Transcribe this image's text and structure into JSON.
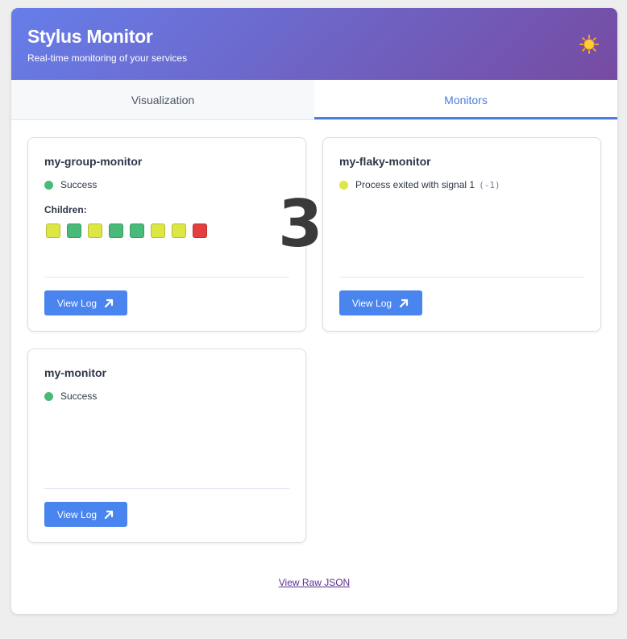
{
  "header": {
    "title": "Stylus Monitor",
    "subtitle": "Real-time monitoring of your services",
    "theme_icon": "sun-icon"
  },
  "tabs": [
    {
      "label": "Visualization",
      "active": false
    },
    {
      "label": "Monitors",
      "active": true
    }
  ],
  "monitors": [
    {
      "name": "my-group-monitor",
      "status": "Success",
      "status_color": "#48bb78",
      "children_label": "Children:",
      "children": [
        "#dce744",
        "#48bb78",
        "#dce744",
        "#48bb78",
        "#48bb78",
        "#dce744",
        "#dce744",
        "#e53e3e"
      ],
      "button": "View Log"
    },
    {
      "name": "my-flaky-monitor",
      "status": "Process exited with signal 1",
      "status_code": "(-1)",
      "status_color": "#dce744",
      "button": "View Log"
    },
    {
      "name": "my-monitor",
      "status": "Success",
      "status_color": "#48bb78",
      "button": "View Log"
    }
  ],
  "overlay_number": "3",
  "footer": {
    "raw_json_link": "View Raw JSON"
  },
  "colors": {
    "accent": "#4a84ee",
    "header_gradient_start": "#667eea",
    "header_gradient_end": "#764ba2",
    "success": "#48bb78",
    "warning": "#dce744",
    "error": "#e53e3e"
  }
}
